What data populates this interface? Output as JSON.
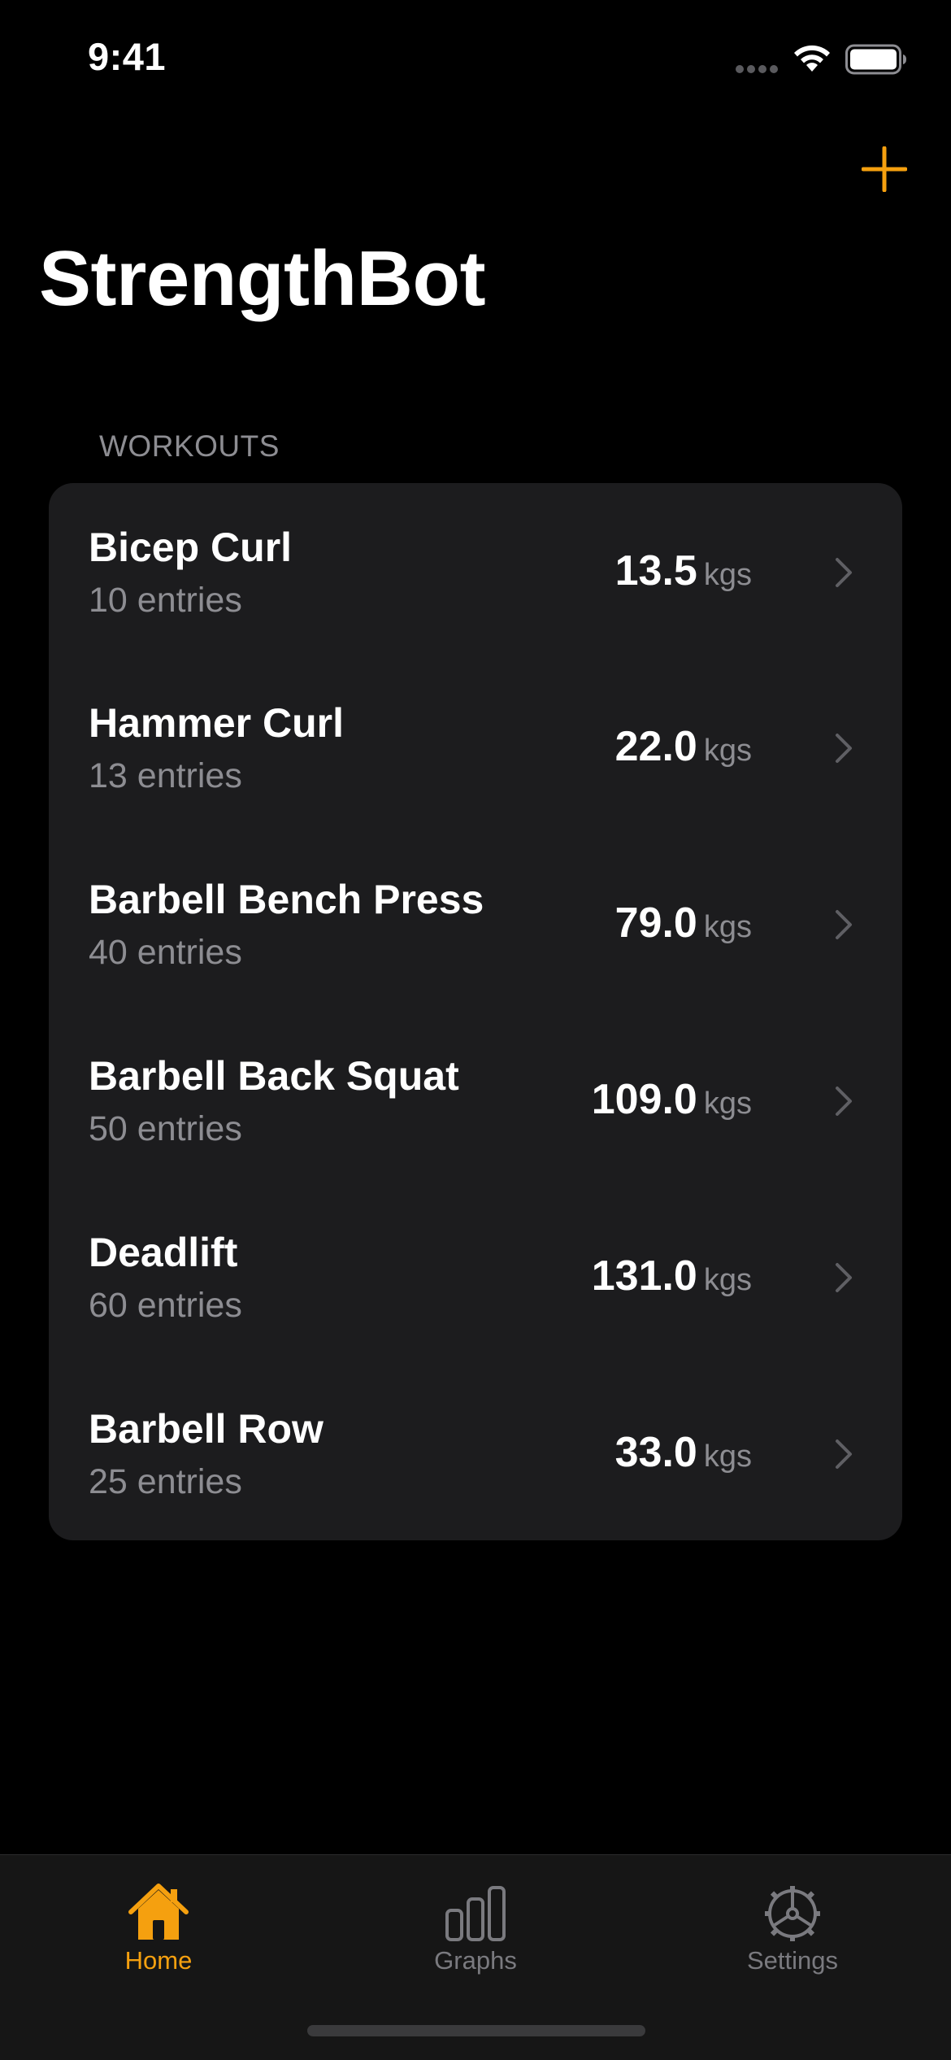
{
  "status_bar": {
    "time": "9:41"
  },
  "nav": {
    "title": "StrengthBot",
    "add_icon": "plus-icon"
  },
  "section": {
    "header": "WORKOUTS"
  },
  "workouts": [
    {
      "name": "Bicep Curl",
      "entries": "10 entries",
      "value": "13.5",
      "unit": "kgs"
    },
    {
      "name": "Hammer Curl",
      "entries": "13 entries",
      "value": "22.0",
      "unit": "kgs"
    },
    {
      "name": "Barbell Bench Press",
      "entries": "40 entries",
      "value": "79.0",
      "unit": "kgs"
    },
    {
      "name": "Barbell Back Squat",
      "entries": "50 entries",
      "value": "109.0",
      "unit": "kgs"
    },
    {
      "name": "Deadlift",
      "entries": "60 entries",
      "value": "131.0",
      "unit": "kgs"
    },
    {
      "name": "Barbell Row",
      "entries": "25 entries",
      "value": "33.0",
      "unit": "kgs"
    }
  ],
  "tab_bar": {
    "tabs": [
      {
        "label": "Home",
        "icon": "house-icon",
        "selected": true
      },
      {
        "label": "Graphs",
        "icon": "bar-chart-icon",
        "selected": false
      },
      {
        "label": "Settings",
        "icon": "gear-icon",
        "selected": false
      }
    ]
  },
  "colors": {
    "accent": "#f5a00f",
    "background": "#000000",
    "card": "#1c1c1e",
    "secondary_text": "#8d8d92",
    "inactive_tab": "#7a7a7f"
  }
}
